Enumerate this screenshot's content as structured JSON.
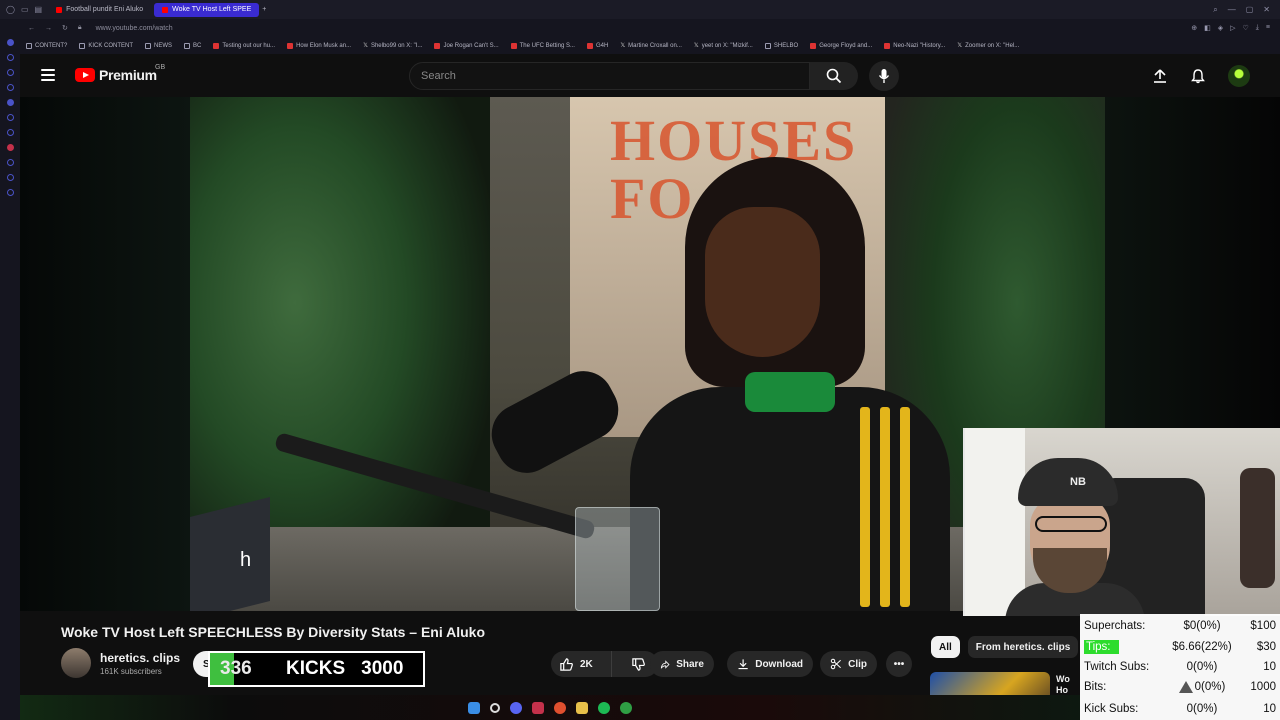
{
  "browser": {
    "tabs": [
      {
        "label": "Football pundit Eni Aluko",
        "active": false
      },
      {
        "label": "Woke TV Host Left SPEE",
        "active": true
      }
    ],
    "new_tab_symbol": "+",
    "url": "www.youtube.com/watch",
    "bookmarks": [
      {
        "label": "CONTENT?",
        "icon": "folder-icon"
      },
      {
        "label": "KICK CONTENT",
        "icon": "folder-icon"
      },
      {
        "label": "NEWS",
        "icon": "folder-icon"
      },
      {
        "label": "BC",
        "icon": "folder-icon"
      },
      {
        "label": "Testing out our hu...",
        "icon": "youtube-icon"
      },
      {
        "label": "How Elon Musk an...",
        "icon": "youtube-icon"
      },
      {
        "label": "Shelbo99 on X: \"I...",
        "icon": "x-icon"
      },
      {
        "label": "Joe Rogan Can't S...",
        "icon": "youtube-icon"
      },
      {
        "label": "The UFC Betting S...",
        "icon": "youtube-icon"
      },
      {
        "label": "G4H",
        "icon": "youtube-icon"
      },
      {
        "label": "Martine Croxall on...",
        "icon": "x-icon"
      },
      {
        "label": "yeet on X: \"Mizkif...",
        "icon": "x-icon"
      },
      {
        "label": "SHELBO",
        "icon": "folder-icon"
      },
      {
        "label": "George Floyd and...",
        "icon": "youtube-icon"
      },
      {
        "label": "Neo-Nazi \"History...",
        "icon": "youtube-icon"
      },
      {
        "label": "Zoomer on X: \"Hel...",
        "icon": "x-icon"
      }
    ]
  },
  "youtube": {
    "logo_text": "Premium",
    "region": "GB",
    "search_placeholder": "Search",
    "video_overlay_caption": "h",
    "video_sign_text": "HOUSES\nFO",
    "video_title": "Woke TV Host Left SPEECHLESS By Diversity Stats – Eni Aluko",
    "channel": {
      "name": "heretics. clips",
      "subscribers": "161K subscribers",
      "subscribe_fragment": "S"
    },
    "actions": {
      "likes": "2K",
      "share": "Share",
      "download": "Download",
      "clip": "Clip"
    },
    "chips": [
      {
        "label": "All",
        "active": true
      },
      {
        "label": "From heretics. clips",
        "active": false
      }
    ],
    "suggested_title_fragment": "Wo\nHo"
  },
  "kicks_goal": {
    "current": "336",
    "label": "KICKS",
    "goal": "3000",
    "progress": 0.112,
    "fill_color": "#3fbf3f"
  },
  "webcam": {
    "cap_logo": "NB"
  },
  "stats": {
    "rows": [
      {
        "label": "Superchats:",
        "value": "$0(0%)",
        "goal": "$100"
      },
      {
        "label": "Tips:",
        "value": "$6.66(22%)",
        "goal": "$30",
        "highlight": "#2ddc2d"
      },
      {
        "label": "Twitch Subs:",
        "value": "0(0%)",
        "goal": "10"
      },
      {
        "label": "Bits:",
        "value": "0(0%)",
        "goal": "1000"
      },
      {
        "label": "Kick Subs:",
        "value": "0(0%)",
        "goal": "10"
      }
    ]
  }
}
